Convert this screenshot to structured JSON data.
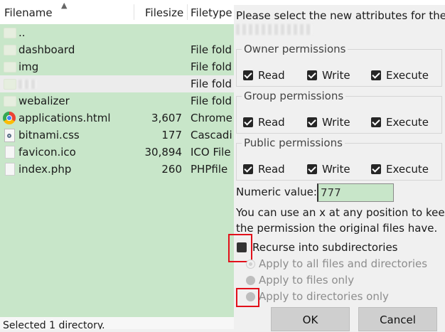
{
  "file_list": {
    "columns": {
      "filename": "Filename",
      "filesize": "Filesize",
      "filetype": "Filetype"
    },
    "rows": [
      {
        "name": "..",
        "size": "",
        "type": "",
        "icon": "folder-icon"
      },
      {
        "name": "dashboard",
        "size": "",
        "type": "File fold",
        "icon": "folder-icon"
      },
      {
        "name": "img",
        "size": "",
        "type": "File fold",
        "icon": "folder-icon"
      },
      {
        "name": "",
        "size": "",
        "type": "File fold",
        "icon": "folder-icon",
        "redacted": true
      },
      {
        "name": "webalizer",
        "size": "",
        "type": "File fold",
        "icon": "folder-icon"
      },
      {
        "name": "applications.html",
        "size": "3,607",
        "type": "Chrome",
        "icon": "chrome-icon"
      },
      {
        "name": "bitnami.css",
        "size": "177",
        "type": "Cascadi",
        "icon": "css-file-icon"
      },
      {
        "name": "favicon.ico",
        "size": "30,894",
        "type": "ICO File",
        "icon": "file-icon"
      },
      {
        "name": "index.php",
        "size": "260",
        "type": "PHPfile",
        "icon": "file-icon"
      }
    ],
    "status": "Selected 1 directory."
  },
  "dialog": {
    "prompt": "Please select the new attributes for the",
    "groups": [
      {
        "label": "Owner permissions",
        "checkboxes": [
          {
            "label": "Read",
            "checked": true
          },
          {
            "label": "Write",
            "checked": true
          },
          {
            "label": "Execute",
            "checked": true
          }
        ]
      },
      {
        "label": "Group permissions",
        "checkboxes": [
          {
            "label": "Read",
            "checked": true
          },
          {
            "label": "Write",
            "checked": true
          },
          {
            "label": "Execute",
            "checked": true
          }
        ]
      },
      {
        "label": "Public permissions",
        "checkboxes": [
          {
            "label": "Read",
            "checked": true
          },
          {
            "label": "Write",
            "checked": true
          },
          {
            "label": "Execute",
            "checked": true
          }
        ]
      }
    ],
    "numeric_label": "Numeric value:",
    "numeric_value": "777",
    "hint_line1": "You can use an x at any position to keep",
    "hint_line2": "the permission the original files have.",
    "recurse_label": "Recurse into subdirectories",
    "recurse_checked": false,
    "radio_options": [
      {
        "label": "Apply to all files and directories",
        "selected": true,
        "enabled": false
      },
      {
        "label": "Apply to files only",
        "selected": false,
        "enabled": false
      },
      {
        "label": "Apply to directories only",
        "selected": false,
        "enabled": false
      }
    ],
    "ok_label": "OK",
    "cancel_label": "Cancel"
  },
  "colors": {
    "list_background": "#c8e6c9",
    "highlight_box": "#e2101a",
    "button_background": "#cfcfcf"
  }
}
